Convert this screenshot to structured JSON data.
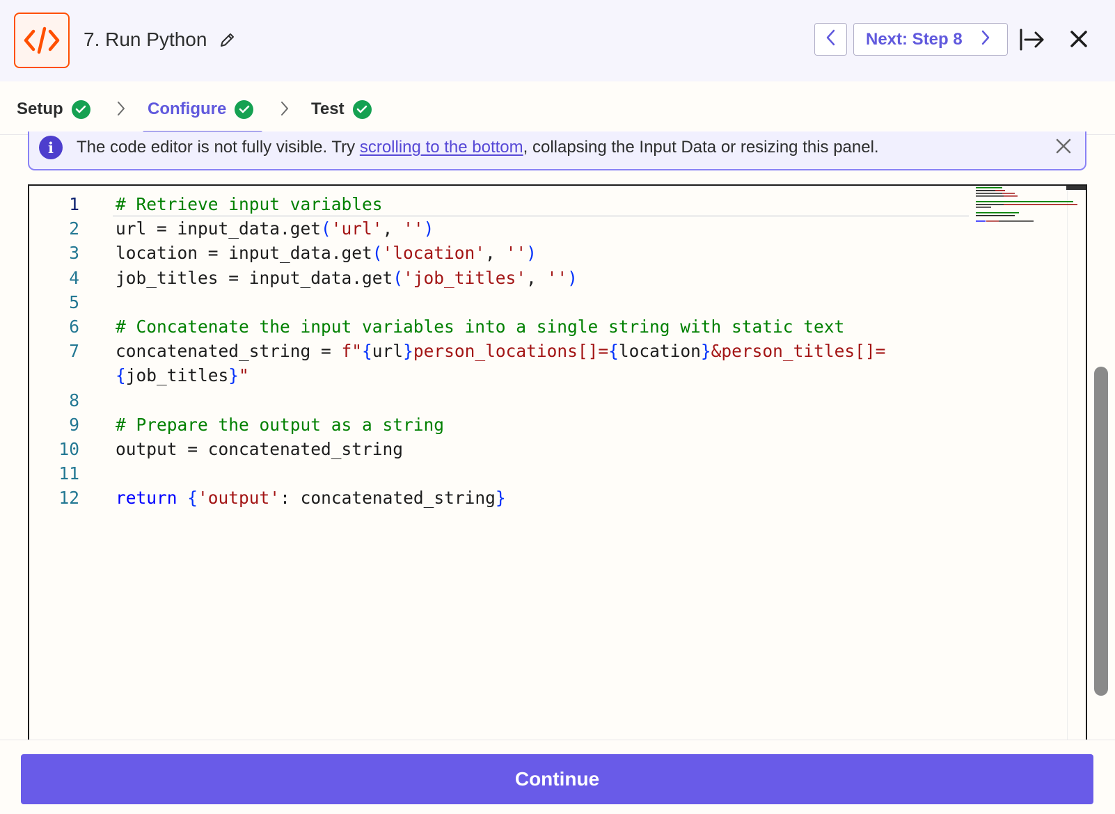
{
  "header": {
    "title": "7. Run Python",
    "next_label": "Next: Step 8"
  },
  "tabs": [
    {
      "label": "Setup",
      "status": "complete"
    },
    {
      "label": "Configure",
      "status": "complete",
      "active": true
    },
    {
      "label": "Test",
      "status": "complete"
    }
  ],
  "notice": {
    "text_before": "The code editor is not fully visible. Try ",
    "link_text": "scrolling to the bottom",
    "text_after": ", collapsing the Input Data or resizing this panel."
  },
  "editor": {
    "language": "python",
    "current_line": 1,
    "lines": [
      {
        "no": "1",
        "text": "# Retrieve input variables"
      },
      {
        "no": "2",
        "text": "url = input_data.get('url', '')"
      },
      {
        "no": "3",
        "text": "location = input_data.get('location', '')"
      },
      {
        "no": "4",
        "text": "job_titles = input_data.get('job_titles', '')"
      },
      {
        "no": "5",
        "text": ""
      },
      {
        "no": "6",
        "text": "# Concatenate the input variables into a single string with static text"
      },
      {
        "no": "7",
        "text": "concatenated_string = f\"{url}person_locations[]={location}&person_titles[]="
      },
      {
        "no": "",
        "text": "{job_titles}\""
      },
      {
        "no": "8",
        "text": ""
      },
      {
        "no": "9",
        "text": "# Prepare the output as a string"
      },
      {
        "no": "10",
        "text": "output = concatenated_string"
      },
      {
        "no": "11",
        "text": ""
      },
      {
        "no": "12",
        "text": "return {'output': concatenated_string}"
      }
    ]
  },
  "footer": {
    "continue_label": "Continue"
  },
  "colors": {
    "accent": "#6059dd",
    "button": "#695be8",
    "success": "#15a152",
    "brand_orange": "#ff4f00"
  },
  "icons": [
    "code-icon",
    "pencil-icon",
    "chevron-left-icon",
    "chevron-right-icon",
    "collapse-panel-icon",
    "close-icon",
    "check-circle-icon",
    "info-icon"
  ]
}
